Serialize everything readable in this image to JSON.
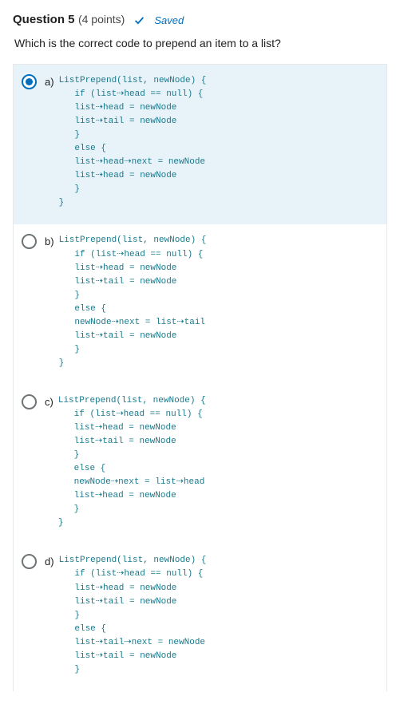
{
  "question": {
    "number": "Question 5",
    "points": "(4 points)",
    "saved": "Saved",
    "prompt": "Which is the correct code to prepend an item to a list?"
  },
  "options": [
    {
      "label": "a)",
      "selected": true,
      "code": "ListPrepend(list, newNode) {\n   if (list⇢head == null) {\n   list⇢head = newNode\n   list⇢tail = newNode\n   }\n   else {\n   list⇢head⇢next = newNode\n   list⇢head = newNode\n   }\n}"
    },
    {
      "label": "b)",
      "selected": false,
      "code": "ListPrepend(list, newNode) {\n   if (list⇢head == null) {\n   list⇢head = newNode\n   list⇢tail = newNode\n   }\n   else {\n   newNode⇢next = list⇢tail\n   list⇢tail = newNode\n   }\n}"
    },
    {
      "label": "c)",
      "selected": false,
      "code": "ListPrepend(list, newNode) {\n   if (list⇢head == null) {\n   list⇢head = newNode\n   list⇢tail = newNode\n   }\n   else {\n   newNode⇢next = list⇢head\n   list⇢head = newNode\n   }\n}"
    },
    {
      "label": "d)",
      "selected": false,
      "code": "ListPrepend(list, newNode) {\n   if (list⇢head == null) {\n   list⇢head = newNode\n   list⇢tail = newNode\n   }\n   else {\n   list⇢tail⇢next = newNode\n   list⇢tail = newNode\n   }"
    }
  ]
}
